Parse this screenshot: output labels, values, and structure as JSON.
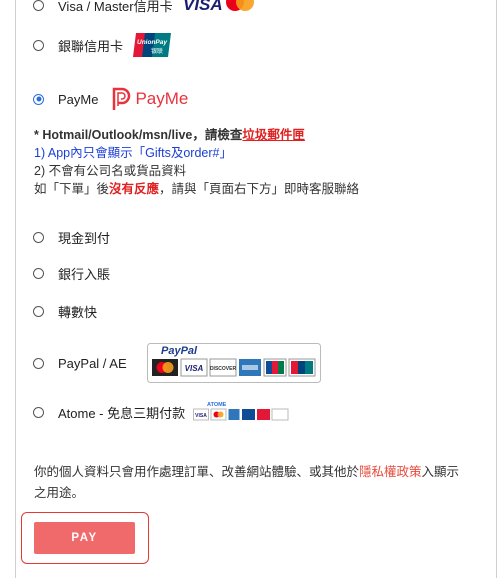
{
  "options": [
    {
      "id": "visa_master",
      "label": "Visa / Master信用卡",
      "selected": false,
      "logos": [
        "VISA",
        "Mastercard"
      ]
    },
    {
      "id": "unionpay",
      "label": "銀聯信用卡",
      "selected": false,
      "logo_text": [
        "UnionPay",
        "银联"
      ]
    },
    {
      "id": "payme",
      "label": "PayMe",
      "selected": true,
      "logo_text": "PayMe"
    },
    {
      "id": "cash",
      "label": "現金到付",
      "selected": false
    },
    {
      "id": "bank",
      "label": "銀行入賬",
      "selected": false
    },
    {
      "id": "fps",
      "label": "轉數快",
      "selected": false
    },
    {
      "id": "paypal",
      "label": "PayPal / AE",
      "selected": false,
      "logo_text": "PayPal",
      "cards": [
        "MasterCard",
        "VISA",
        "DISCOVER",
        "AMEX",
        "JCB",
        "UnionPay"
      ]
    },
    {
      "id": "atome",
      "label": "Atome - 免息三期付款",
      "selected": false,
      "logo_text": "ATOME"
    }
  ],
  "payme_note": {
    "line1_prefix": "* Hotmail/Outlook/msn/live，請檢查",
    "line1_link": "垃圾郵件匣",
    "line2_prefix": "1) App內",
    "line2_blue": "只會顯示「Gifts及order#」",
    "line3": "2) 不會有公司名或貨品資料",
    "line4_prefix": "如「下單」後",
    "line4_red": "沒有反應",
    "line4_suffix": "，請與「頁面右下方」即時客服聯絡"
  },
  "privacy": {
    "prefix": "你的個人資料只會用作處理訂單、改善網站體驗、或其他於",
    "link": "隱私權政策",
    "suffix": "入顯示之用途。"
  },
  "pay_button": "PAY",
  "colors": {
    "accent_red": "#e53935",
    "pay_bg": "#f0696b",
    "radio_selected": "#2a6edb",
    "payme_red": "#e8333c"
  }
}
